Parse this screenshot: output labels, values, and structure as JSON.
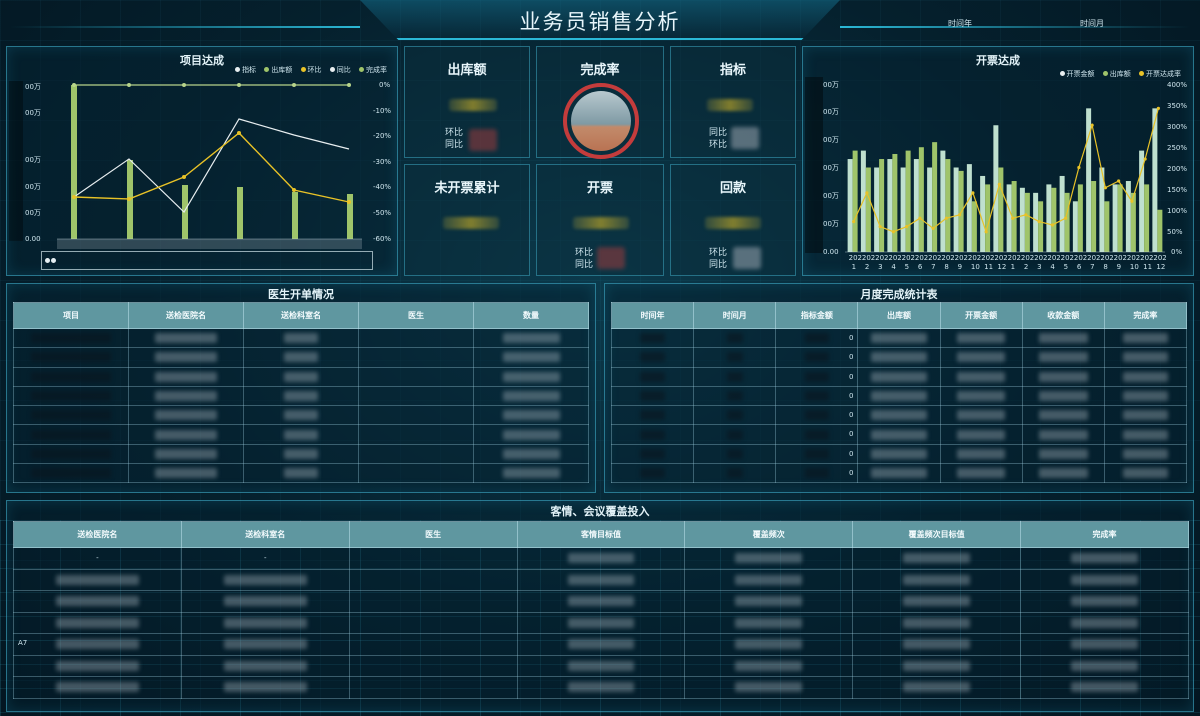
{
  "header": {
    "title": "业务员销售分析",
    "filter_year_label": "时间年",
    "filter_month_label": "时间月"
  },
  "project_chart": {
    "title": "项目达成",
    "legend": [
      {
        "label": "指标",
        "color": "#e8eef0"
      },
      {
        "label": "出库额",
        "color": "#9fc46a"
      },
      {
        "label": "环比",
        "color": "#e8c227"
      },
      {
        "label": "同比",
        "color": "#e8eef0"
      },
      {
        "label": "完成率",
        "color": "#9fc46a"
      }
    ],
    "left_ticks": [
      "00万",
      "00万",
      "00万",
      "00万",
      "00万",
      "0.00"
    ],
    "right_ticks": [
      "0%",
      "-10%",
      "-20%",
      "-30%",
      "-40%",
      "-50%",
      "-60%"
    ]
  },
  "invoice_chart": {
    "title": "开票达成",
    "legend": [
      {
        "label": "开票金额",
        "color": "#e8eef0"
      },
      {
        "label": "出库额",
        "color": "#9fc46a"
      },
      {
        "label": "开票达成率",
        "color": "#e8c227"
      }
    ],
    "left_ticks": [
      "00万",
      "00万",
      "00万",
      "00万",
      "00万",
      "00万",
      "0.00"
    ],
    "right_ticks": [
      "400%",
      "350%",
      "300%",
      "250%",
      "200%",
      "150%",
      "100%",
      "50%",
      "0%"
    ],
    "x_month_labels": [
      "1",
      "2",
      "3",
      "4",
      "5",
      "6",
      "7",
      "8",
      "9",
      "10",
      "11",
      "12",
      "1",
      "2",
      "3",
      "4",
      "5",
      "6",
      "7",
      "8",
      "9",
      "10",
      "11",
      "12"
    ],
    "x_year_label": "202"
  },
  "kpis": {
    "outbound": {
      "title": "出库额",
      "mom": "环比",
      "yoy": "同比"
    },
    "completion": {
      "title": "完成率"
    },
    "target": {
      "title": "指标",
      "yoy": "同比",
      "mom": "环比"
    },
    "uninvoiced": {
      "title": "未开票累计"
    },
    "invoice": {
      "title": "开票",
      "mom": "环比",
      "yoy": "同比"
    },
    "payment": {
      "title": "回款",
      "mom": "环比",
      "yoy": "同比"
    }
  },
  "doctor_table": {
    "title": "医生开单情况",
    "columns": [
      "项目",
      "送检医院名",
      "送检科室名",
      "医生",
      "数量"
    ],
    "row_count": 8
  },
  "monthly_table": {
    "title": "月度完成统计表",
    "columns": [
      "时间年",
      "时间月",
      "指标金额",
      "出库额",
      "开票金额",
      "收款金额",
      "完成率"
    ],
    "row_count": 8,
    "cell_digit": "0"
  },
  "coverage_table": {
    "title": "客情、会议覆盖投入",
    "columns": [
      "送检医院名",
      "送检科室名",
      "医生",
      "客情目标值",
      "覆盖频次",
      "覆盖频次目标值",
      "完成率"
    ],
    "row_count": 7,
    "first_row_dash": "-",
    "partial_text": "A7"
  }
}
